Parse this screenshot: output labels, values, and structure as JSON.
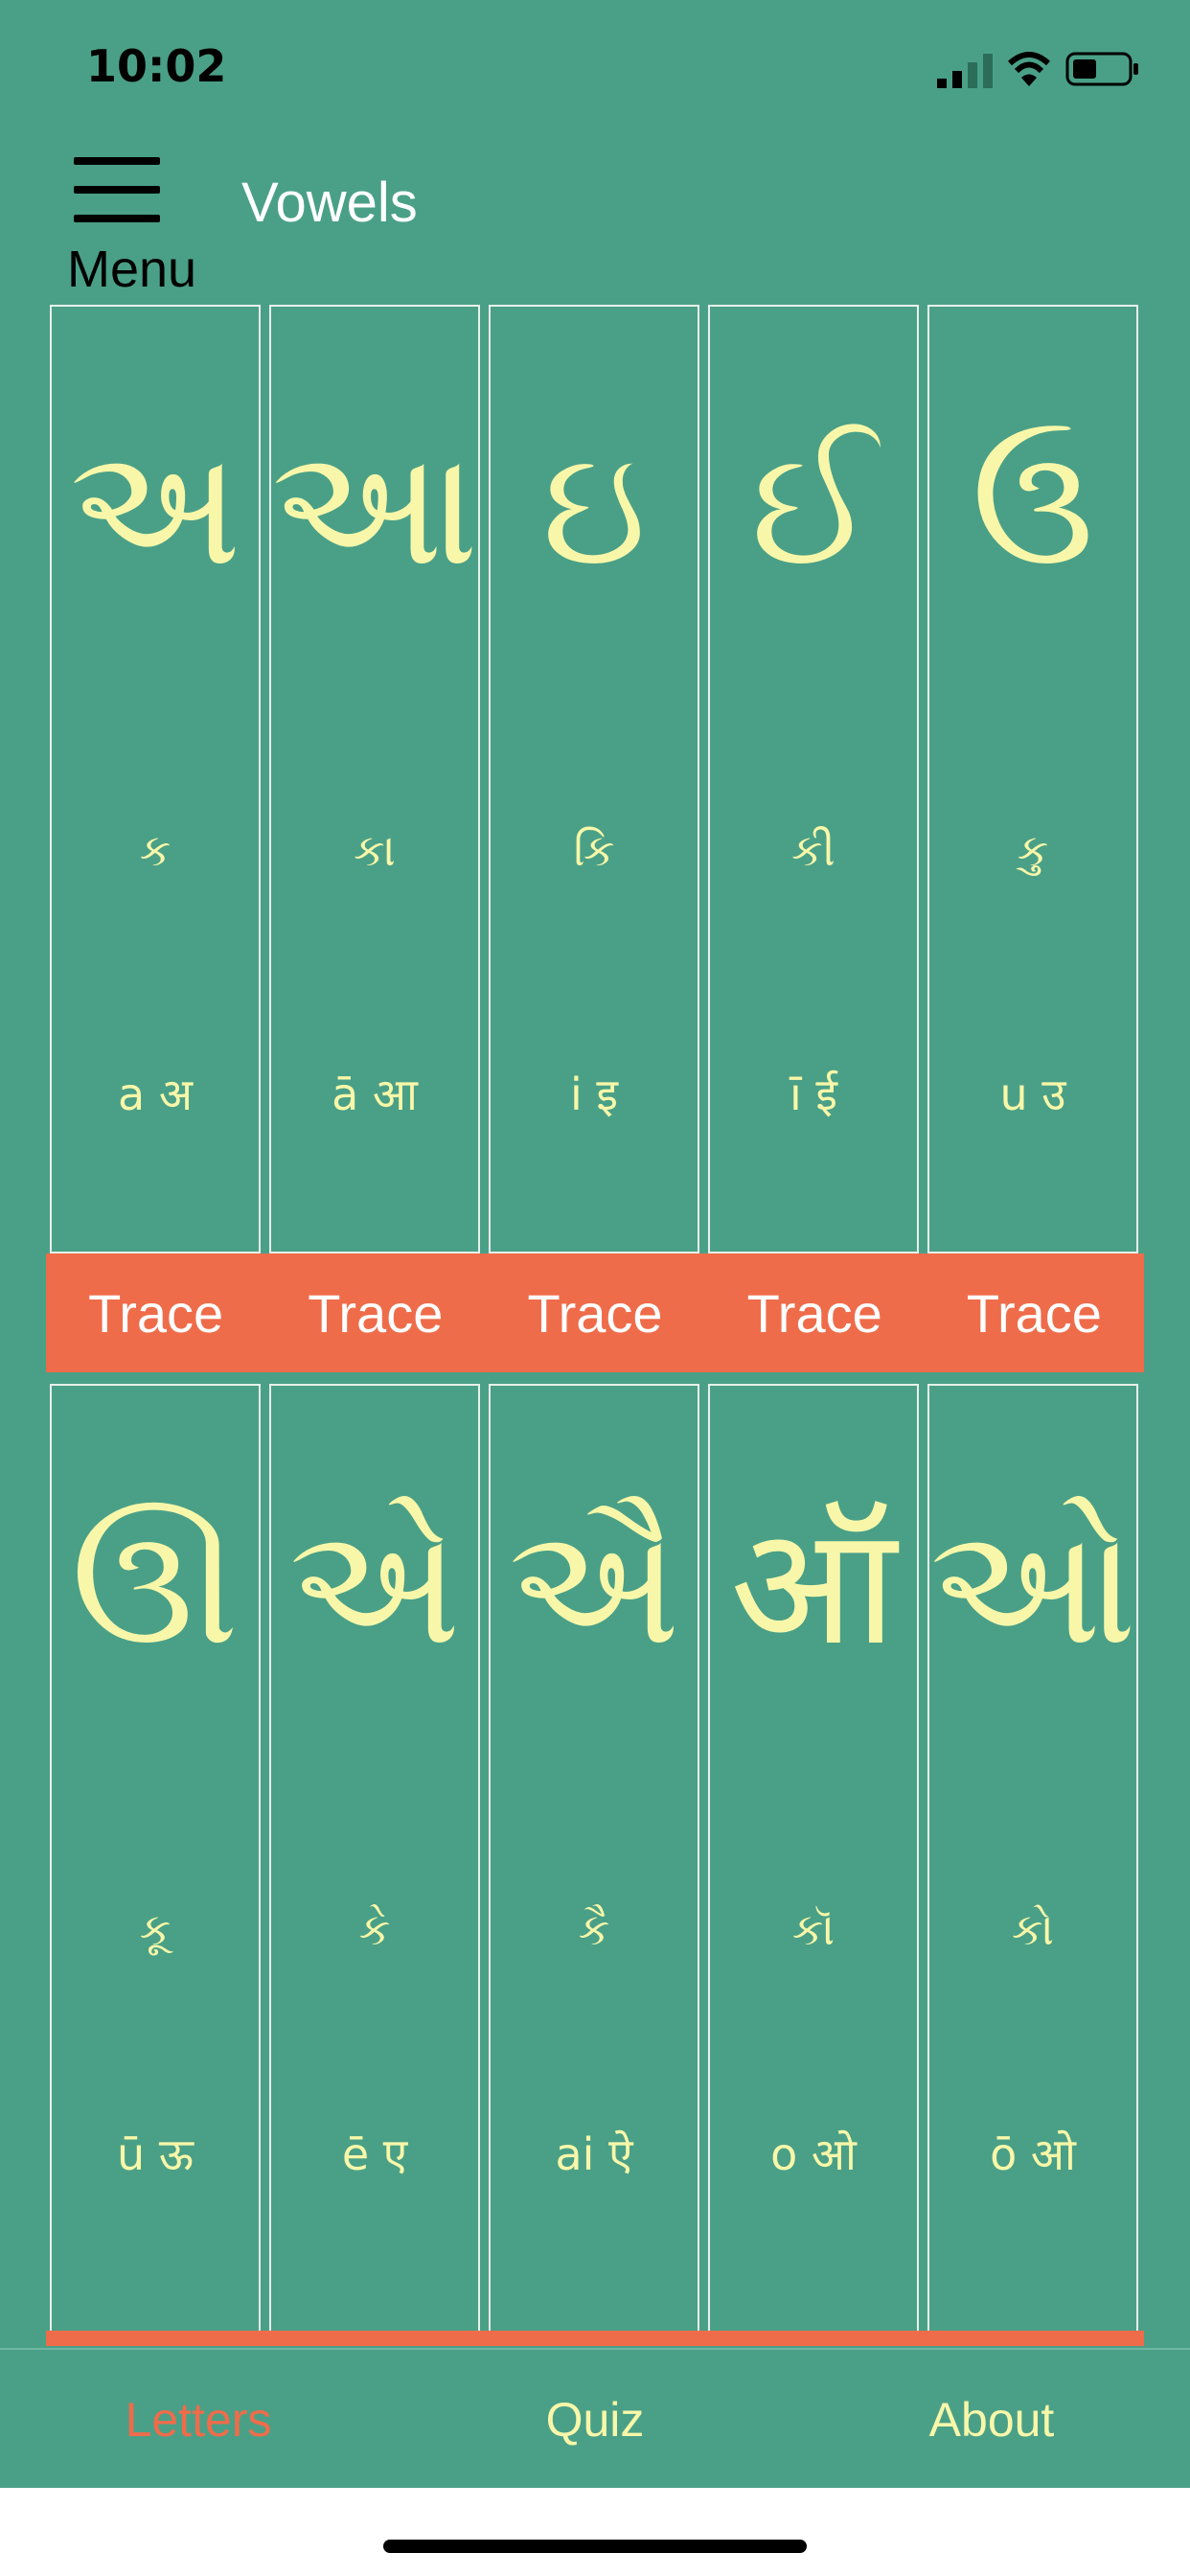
{
  "status_bar": {
    "time": "10:02"
  },
  "nav": {
    "menu_label": "Menu",
    "title": "Vowels"
  },
  "row1": [
    {
      "glyph": "અ",
      "example": "ક",
      "translit": "a अ"
    },
    {
      "glyph": "આ",
      "example": "કા",
      "translit": "ā आ"
    },
    {
      "glyph": "ઇ",
      "example": "કિ",
      "translit": "i इ"
    },
    {
      "glyph": "ઈ",
      "example": "કી",
      "translit": "ī ई"
    },
    {
      "glyph": "ઉ",
      "example": "કુ",
      "translit": "u उ"
    }
  ],
  "trace_labels": [
    "Trace",
    "Trace",
    "Trace",
    "Trace",
    "Trace"
  ],
  "row2": [
    {
      "glyph": "ઊ",
      "example": "કૂ",
      "translit": "ū ऊ"
    },
    {
      "glyph": "એ",
      "example": "કે",
      "translit": "ē ए"
    },
    {
      "glyph": "ઐ",
      "example": "કૈ",
      "translit": "ai ऐ"
    },
    {
      "glyph": "ऑ",
      "example": "કૉ",
      "translit": "o ओ"
    },
    {
      "glyph": "ઓ",
      "example": "કો",
      "translit": "ō ओ"
    }
  ],
  "tabs": {
    "letters": "Letters",
    "quiz": "Quiz",
    "about": "About"
  },
  "colors": {
    "background": "#4aa087",
    "accent": "#ef6c4a",
    "glyph": "#f8f7a9"
  }
}
